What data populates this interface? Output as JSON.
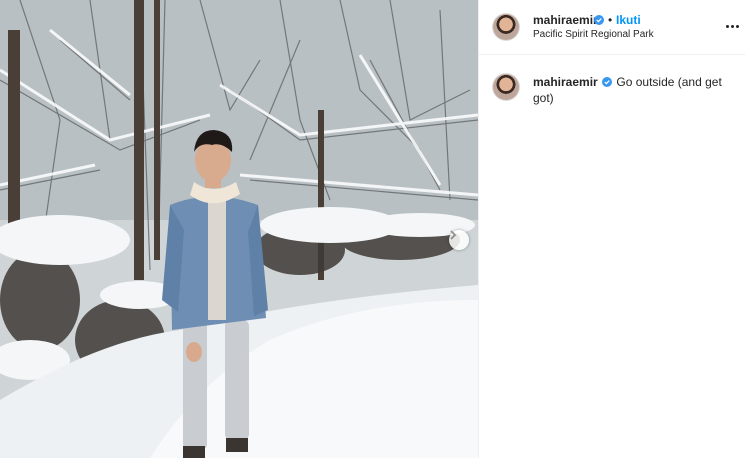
{
  "post": {
    "header": {
      "username": "mahiraemir",
      "separator": "•",
      "follow_label": "Ikuti",
      "location": "Pacific Spirit Regional Park",
      "avatar_icon": "profile-avatar",
      "verified_icon": "verified-badge-icon",
      "more_icon": "more-options-icon"
    },
    "caption": {
      "username": "mahiraemir",
      "text": "Go outside (and get got)"
    },
    "media": {
      "next_icon": "chevron-right-icon"
    },
    "colors": {
      "accent": "#0095f6",
      "text": "#262626",
      "border": "#efefef"
    }
  }
}
